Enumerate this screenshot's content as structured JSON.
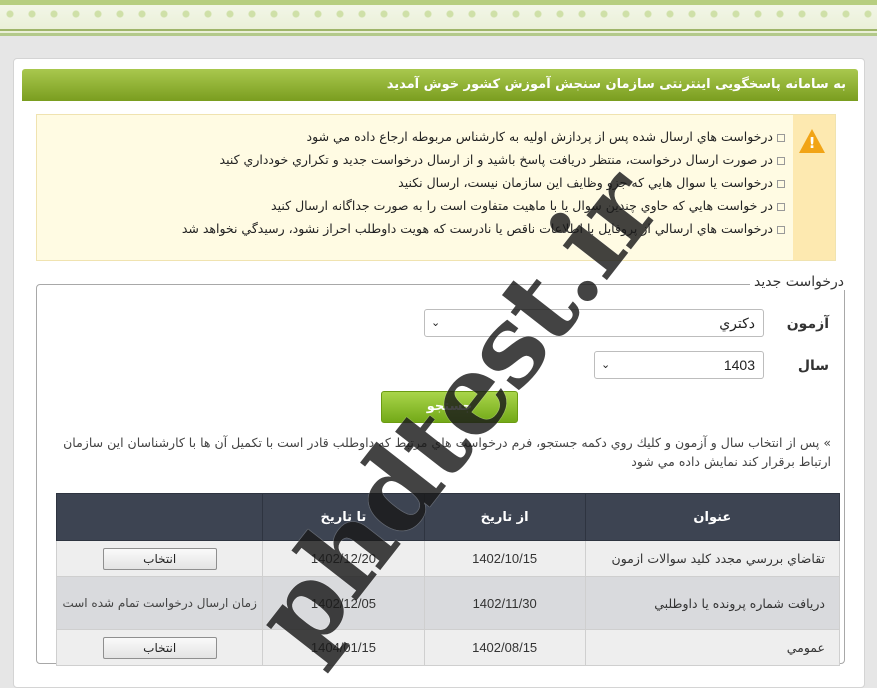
{
  "welcome": "به سامانه پاسخگویی اینترنتی سازمان سنجش آموزش کشور خوش آمدید",
  "notices": [
    "درخواست هاي ارسال شده پس از پردازش اوليه به كارشناس مربوطه ارجاع داده مي شود",
    "در صورت ارسال درخواست، منتظر دريافت پاسخ باشيد و از ارسال درخواست جديد و تكراري خودداري كنيد",
    "درخواست يا سوال هايي كه جزو وظايف اين سازمان نيست، ارسال نكنيد",
    "در خواست هايي كه حاوي چندين سوال يا با ماهيت متفاوت است را به صورت جداگانه ارسال كنيد",
    "درخواست هاي ارسالي از پروفايل با اطلاعات ناقص يا نادرست كه هويت داوطلب احراز نشود، رسيدگي نخواهد شد"
  ],
  "form": {
    "legend": "درخواست جديد",
    "exam_label": "آزمون",
    "exam_value": "دكتري",
    "year_label": "سال",
    "year_value": "1403",
    "search_label": "جستجو",
    "hint": "» پس از انتخاب سال و آزمون و كليك روي دكمه جستجو، فرم درخواست هاي مرتبط كه داوطلب قادر است با تكميل آن ها با كارشناسان اين سازمان ارتباط برقرار كند نمايش داده مي شود"
  },
  "table": {
    "headers": [
      "عنوان",
      "از تاريخ",
      "تا تاريخ",
      ""
    ],
    "rows": [
      {
        "title": "تقاضاي بررسي مجدد كليد سوالات ازمون",
        "from": "1402/10/15",
        "to": "1402/12/20",
        "action": "انتخاب"
      },
      {
        "title": "دريافت شماره پرونده يا داوطلبي",
        "from": "1402/11/30",
        "to": "1402/12/05",
        "status": "زمان ارسال درخواست تمام شده است"
      },
      {
        "title": "عمومي",
        "from": "1402/08/15",
        "to": "1404/01/15",
        "action": "انتخاب"
      }
    ]
  },
  "watermark": "phdtest.ir",
  "colors": {
    "accent_green": "#8ab33a",
    "table_header": "#3d4452",
    "warning": "#f1a416"
  }
}
